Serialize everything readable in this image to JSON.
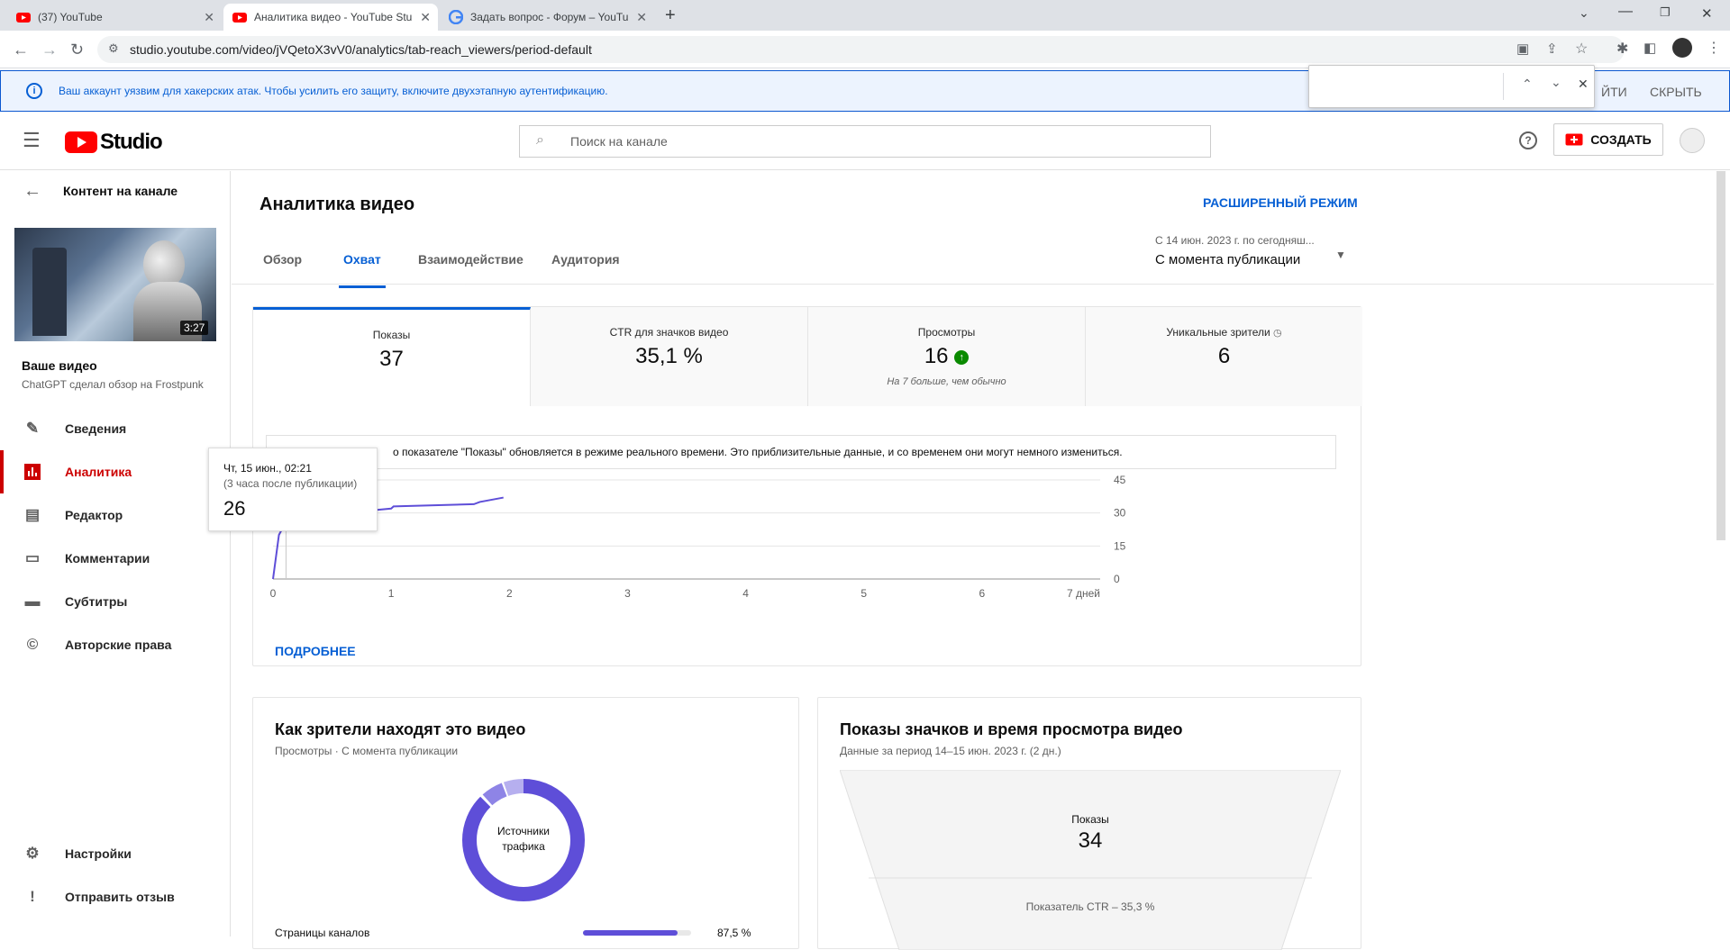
{
  "browser": {
    "tabs": [
      {
        "title": "(37) YouTube",
        "icon": "youtube-icon"
      },
      {
        "title": "Аналитика видео - YouTube Stu",
        "icon": "youtube-icon"
      },
      {
        "title": "Задать вопрос - Форум – YouTu",
        "icon": "google-icon"
      }
    ],
    "url": "studio.youtube.com/video/jVQetoX3vV0/analytics/tab-reach_viewers/period-default"
  },
  "banner": {
    "text": "Ваш аккаунт уязвим для хакерских атак. Чтобы усилить его защиту, включите двухэтапную аутентификацию.",
    "action_partial": "ЙТИ",
    "hide": "СКРЫТЬ"
  },
  "header": {
    "logo": "Studio",
    "search_placeholder": "Поиск на канале",
    "create": "СОЗДАТЬ"
  },
  "sidebar": {
    "back_label": "Контент на канале",
    "video_duration": "3:27",
    "your_video": "Ваше видео",
    "video_title": "ChatGPT сделал обзор на Frostpunk",
    "items": [
      {
        "label": "Сведения",
        "icon": "pencil-icon"
      },
      {
        "label": "Аналитика",
        "icon": "analytics-icon"
      },
      {
        "label": "Редактор",
        "icon": "editor-icon"
      },
      {
        "label": "Комментарии",
        "icon": "comments-icon"
      },
      {
        "label": "Субтитры",
        "icon": "subtitles-icon"
      },
      {
        "label": "Авторские права",
        "icon": "copyright-icon"
      }
    ],
    "bottom": [
      {
        "label": "Настройки",
        "icon": "gear-icon"
      },
      {
        "label": "Отправить отзыв",
        "icon": "feedback-icon"
      }
    ]
  },
  "page": {
    "title": "Аналитика видео",
    "advanced": "РАСШИРЕННЫЙ РЕЖИМ",
    "tabs": [
      "Обзор",
      "Охват",
      "Взаимодействие",
      "Аудитория"
    ],
    "period_caption": "С 14 июн. 2023 г. по сегодняш...",
    "period_value": "С момента публикации"
  },
  "metrics": [
    {
      "label": "Показы",
      "value": "37",
      "note": ""
    },
    {
      "label": "CTR для значков видео",
      "value": "35,1 %",
      "note": ""
    },
    {
      "label": "Просмотры",
      "value": "16",
      "note": "На 7 больше, чем обычно"
    },
    {
      "label": "Уникальные зрители",
      "value": "6",
      "note": ""
    }
  ],
  "notice": "о показателе \"Показы\" обновляется в режиме реального времени. Это приблизительные данные, и со временем они могут немного измениться.",
  "tooltip": {
    "date": "Чт, 15 июн., 02:21",
    "sub": "(3 часа после публикации)",
    "value": "26"
  },
  "more_link": "ПОДРОБНЕЕ",
  "chart_data": {
    "type": "line",
    "x_ticks": [
      "0",
      "1",
      "2",
      "3",
      "4",
      "5",
      "6",
      "7 дней"
    ],
    "y_ticks": [
      "45",
      "30",
      "15",
      "0"
    ],
    "ylim": [
      0,
      45
    ],
    "xlim": [
      0,
      7
    ],
    "x": [
      0,
      0.05,
      0.11,
      0.3,
      0.53,
      0.6,
      0.62,
      0.75,
      0.8,
      1.0,
      1.02,
      1.7,
      1.75,
      1.95
    ],
    "y": [
      0,
      20,
      26,
      27,
      27,
      28,
      29,
      30,
      31,
      32,
      33,
      34,
      35,
      37
    ],
    "color": "#5e4ed8"
  },
  "traffic": {
    "title": "Как зрители находят это видео",
    "subtitle": "Просмотры · С момента публикации",
    "donut_label": "Источники трафика",
    "rows": [
      {
        "label": "Страницы каналов",
        "value": "87,5 %",
        "fraction": 0.875
      }
    ]
  },
  "funnel": {
    "title": "Показы значков и время просмотра видео",
    "subtitle": "Данные за период 14–15 июн. 2023 г. (2 дн.)",
    "top_label": "Показы",
    "top_value": "34",
    "ctr": "Показатель CTR – 35,3 %"
  }
}
